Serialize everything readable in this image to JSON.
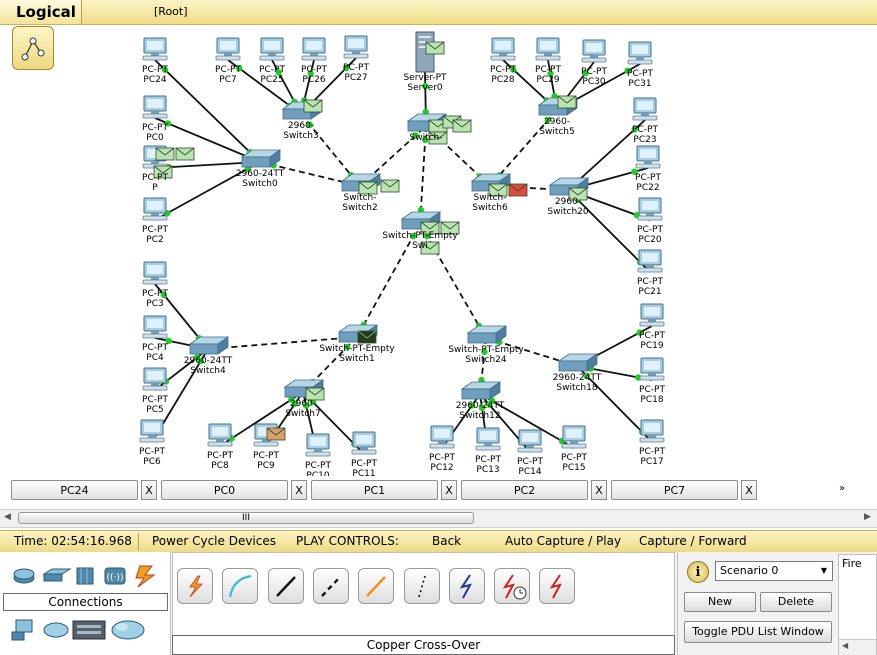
{
  "header": {
    "logical_tab": "Logical",
    "root_label": "[Root]"
  },
  "logical_icon": "logical-topology-icon",
  "devices": [
    {
      "id": "server0",
      "kind": "server",
      "l1": "Server-PT",
      "l2": "Server0"
    },
    {
      "id": "pc24",
      "kind": "pc",
      "l1": "PC-PT",
      "l2": "PC24"
    },
    {
      "id": "pc0",
      "kind": "pc",
      "l1": "PC-PT",
      "l2": "PC0"
    },
    {
      "id": "pc1",
      "kind": "pc",
      "l1": "PC-PT",
      "l2": "P"
    },
    {
      "id": "pc2",
      "kind": "pc",
      "l1": "PC-PT",
      "l2": "PC2"
    },
    {
      "id": "pc7",
      "kind": "pc",
      "l1": "PC-PT",
      "l2": "PC7"
    },
    {
      "id": "pc25",
      "kind": "pc",
      "l1": "PC-PT",
      "l2": "PC25"
    },
    {
      "id": "pc26",
      "kind": "pc",
      "l1": "PC-PT",
      "l2": "PC26"
    },
    {
      "id": "pc27",
      "kind": "pc",
      "l1": "PC-PT",
      "l2": "PC27"
    },
    {
      "id": "pc28",
      "kind": "pc",
      "l1": "PC-PT",
      "l2": "PC28"
    },
    {
      "id": "pc29",
      "kind": "pc",
      "l1": "PC-PT",
      "l2": "PC29"
    },
    {
      "id": "pc30",
      "kind": "pc",
      "l1": "PC-PT",
      "l2": "PC30"
    },
    {
      "id": "pc31",
      "kind": "pc",
      "l1": "PC-PT",
      "l2": "PC31"
    },
    {
      "id": "pc23",
      "kind": "pc",
      "l1": "PC-PT",
      "l2": "PC23"
    },
    {
      "id": "pc22",
      "kind": "pc",
      "l1": "PC-PT",
      "l2": "PC22"
    },
    {
      "id": "pc20",
      "kind": "pc",
      "l1": "PC-PT",
      "l2": "PC20"
    },
    {
      "id": "pc21",
      "kind": "pc",
      "l1": "PC-PT",
      "l2": "PC21"
    },
    {
      "id": "pc3",
      "kind": "pc",
      "l1": "PC-PT",
      "l2": "PC3"
    },
    {
      "id": "pc4",
      "kind": "pc",
      "l1": "PC-PT",
      "l2": "PC4"
    },
    {
      "id": "pc5",
      "kind": "pc",
      "l1": "PC-PT",
      "l2": "PC5"
    },
    {
      "id": "pc6",
      "kind": "pc",
      "l1": "PC-PT",
      "l2": "PC6"
    },
    {
      "id": "pc8",
      "kind": "pc",
      "l1": "PC-PT",
      "l2": "PC8"
    },
    {
      "id": "pc9",
      "kind": "pc",
      "l1": "PC-PT",
      "l2": "PC9"
    },
    {
      "id": "pc10",
      "kind": "pc",
      "l1": "PC-PT",
      "l2": "PC10"
    },
    {
      "id": "pc11",
      "kind": "pc",
      "l1": "PC-PT",
      "l2": "PC11"
    },
    {
      "id": "pc12",
      "kind": "pc",
      "l1": "PC-PT",
      "l2": "PC12"
    },
    {
      "id": "pc13",
      "kind": "pc",
      "l1": "PC-PT",
      "l2": "PC13"
    },
    {
      "id": "pc14",
      "kind": "pc",
      "l1": "PC-PT",
      "l2": "PC14"
    },
    {
      "id": "pc15",
      "kind": "pc",
      "l1": "PC-PT",
      "l2": "PC15"
    },
    {
      "id": "pc19",
      "kind": "pc",
      "l1": "PC-PT",
      "l2": "PC19"
    },
    {
      "id": "pc18",
      "kind": "pc",
      "l1": "PC-PT",
      "l2": "PC18"
    },
    {
      "id": "pc17",
      "kind": "pc",
      "l1": "PC-PT",
      "l2": "PC17"
    },
    {
      "id": "switch0",
      "kind": "switch",
      "l1": "2960-24TT",
      "l2": "Switch0"
    },
    {
      "id": "switch3",
      "kind": "switch",
      "l1": "2960-",
      "l2": "Switch3"
    },
    {
      "id": "switch2",
      "kind": "switch",
      "l1": "Switch-",
      "l2": "Switch2"
    },
    {
      "id": "switchtop",
      "kind": "switch",
      "l1": "Switch-",
      "l2": ""
    },
    {
      "id": "switch5",
      "kind": "switch",
      "l1": "2960-",
      "l2": "Switch5"
    },
    {
      "id": "switch6",
      "kind": "switch",
      "l1": "Switch-",
      "l2": "Switch6"
    },
    {
      "id": "switch20",
      "kind": "switch",
      "l1": "2960-",
      "l2": "Switch20"
    },
    {
      "id": "switchcore",
      "kind": "switch",
      "l1": "Switch-PT-Empty",
      "l2": "Swi"
    },
    {
      "id": "switch1",
      "kind": "switch",
      "l1": "Switch-PT-Empty",
      "l2": "Switch1"
    },
    {
      "id": "switch4",
      "kind": "switch",
      "l1": "2960-24TT",
      "l2": "Switch4"
    },
    {
      "id": "switch7",
      "kind": "switch",
      "l1": "2960-",
      "l2": "Switch7"
    },
    {
      "id": "switch24",
      "kind": "switch",
      "l1": "Switch-PT-Empty",
      "l2": "Switch24"
    },
    {
      "id": "switch12",
      "kind": "switch",
      "l1": "2960-24TT",
      "l2": "Switch12"
    },
    {
      "id": "switch18",
      "kind": "switch",
      "l1": "2960-24TT",
      "l2": "Switch18"
    }
  ],
  "device_tabs": [
    {
      "label": "PC24",
      "close": "X"
    },
    {
      "label": "PC0",
      "close": "X"
    },
    {
      "label": "PC1",
      "close": "X"
    },
    {
      "label": "PC2",
      "close": "X"
    },
    {
      "label": "PC7",
      "close": "X"
    }
  ],
  "device_tabs_more": "»",
  "scrollbar": {
    "left_arrow": "◀",
    "right_arrow": "▶",
    "grip": "III"
  },
  "statusbar": {
    "time": "Time: 02:54:16.968",
    "power_cycle": "Power Cycle Devices",
    "play_controls": "PLAY CONTROLS:",
    "back": "Back",
    "auto_capture": "Auto Capture / Play",
    "capture_forward": "Capture / Forward"
  },
  "device_categories": {
    "label": "Connections",
    "top_icons": [
      "router-icon",
      "switch-icon",
      "hub-icon",
      "wireless-icon",
      "connections-icon"
    ],
    "bottom_icons": [
      "end-devices-icon",
      "wan-emulation-icon",
      "custom-devices-icon",
      "multiuser-cloud-icon"
    ]
  },
  "cables": {
    "selected_label": "Copper Cross-Over",
    "types": [
      "automatic-connection-icon",
      "console-cable-icon",
      "copper-straight-through-icon",
      "copper-cross-over-icon",
      "fiber-icon",
      "phone-cable-icon",
      "coaxial-cable-icon",
      "serial-dce-icon",
      "serial-dte-icon"
    ]
  },
  "scenario": {
    "info": "i",
    "selected": "Scenario 0",
    "new_label": "New",
    "delete_label": "Delete",
    "toggle_label": "Toggle PDU List Window"
  },
  "event_list": {
    "fire_label": "Fire"
  },
  "colors": {
    "link_up": "#22cc22",
    "pdu_green": "#b9e3b0",
    "pdu_red": "#e04a3c",
    "pdu_orange": "#d9a06b",
    "pdu_dark": "#253c1c",
    "status_bg": "#f5e6a2"
  }
}
